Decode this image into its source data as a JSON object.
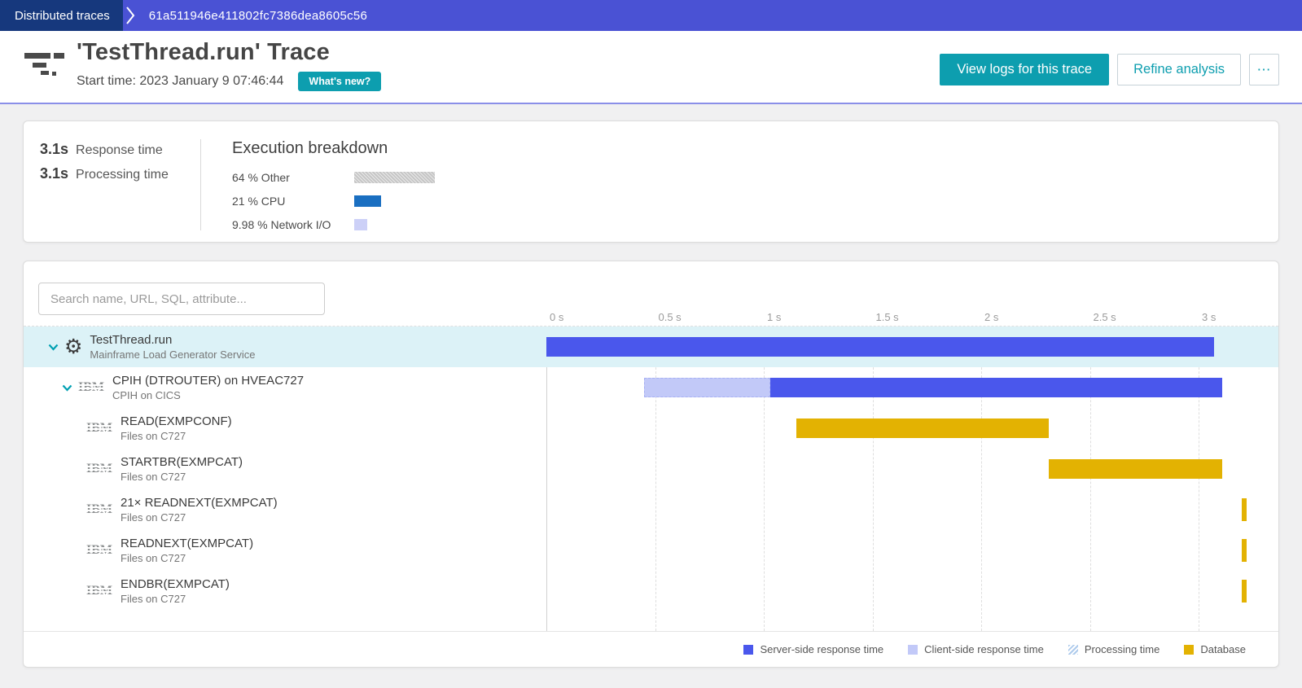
{
  "topbar": {
    "breadcrumb": "Distributed traces",
    "trace_id": "61a511946e411802fc7386dea8605c56"
  },
  "header": {
    "title": "'TestThread.run' Trace",
    "start_time": "Start time: 2023 January 9 07:46:44",
    "whats_new_label": "What's new?",
    "buttons": {
      "view_logs": "View logs for this trace",
      "refine": "Refine analysis",
      "more": "⋯"
    }
  },
  "summary": {
    "metrics": [
      {
        "value": "3.1s",
        "label": "Response time"
      },
      {
        "value": "3.1s",
        "label": "Processing time"
      }
    ],
    "breakdown": {
      "title": "Execution breakdown",
      "items": [
        {
          "label": "64 % Other",
          "pct": 64,
          "type": "other"
        },
        {
          "label": "21 % CPU",
          "pct": 21,
          "type": "cpu"
        },
        {
          "label": "9.98 % Network I/O",
          "pct": 9.98,
          "type": "network"
        }
      ]
    }
  },
  "waterfall": {
    "search_placeholder": "Search name, URL, SQL, attribute...",
    "axis_ticks": [
      {
        "t": 0,
        "label": "0 s"
      },
      {
        "t": 0.5,
        "label": "0.5 s"
      },
      {
        "t": 1,
        "label": "1 s"
      },
      {
        "t": 1.5,
        "label": "1.5 s"
      },
      {
        "t": 2,
        "label": "2 s"
      },
      {
        "t": 2.5,
        "label": "2.5 s"
      },
      {
        "t": 3,
        "label": "3 s"
      }
    ],
    "rows": [
      {
        "name": "TestThread.run",
        "service": "Mainframe Load Generator Service",
        "icon": "gear",
        "expandable": true,
        "highlighted": true,
        "indent": 0,
        "bars": [
          {
            "type": "server",
            "start_s": 0,
            "end_s": 3.07
          }
        ]
      },
      {
        "name": "CPIH (DTROUTER) on HVEAC727",
        "service": "CPIH on CICS",
        "icon": "ibm",
        "expandable": true,
        "highlighted": false,
        "indent": 1,
        "bars": [
          {
            "type": "client",
            "start_s": 0.45,
            "end_s": 1.03
          },
          {
            "type": "server",
            "start_s": 1.03,
            "end_s": 3.11
          }
        ]
      },
      {
        "name": "READ(EXMPCONF)",
        "service": "Files on C727",
        "icon": "ibm",
        "expandable": false,
        "highlighted": false,
        "indent": 2,
        "bars": [
          {
            "type": "database",
            "start_s": 1.15,
            "end_s": 2.31
          }
        ]
      },
      {
        "name": "STARTBR(EXMPCAT)",
        "service": "Files on C727",
        "icon": "ibm",
        "expandable": false,
        "highlighted": false,
        "indent": 2,
        "bars": [
          {
            "type": "database",
            "start_s": 2.31,
            "end_s": 3.11
          }
        ]
      },
      {
        "name": "21× READNEXT(EXMPCAT)",
        "service": "Files on C727",
        "icon": "ibm",
        "expandable": false,
        "highlighted": false,
        "indent": 2,
        "bars": [
          {
            "type": "database",
            "start_s": 3.2,
            "end_s": 3.22
          }
        ]
      },
      {
        "name": "READNEXT(EXMPCAT)",
        "service": "Files on C727",
        "icon": "ibm",
        "expandable": false,
        "highlighted": false,
        "indent": 2,
        "bars": [
          {
            "type": "database",
            "start_s": 3.2,
            "end_s": 3.22
          }
        ]
      },
      {
        "name": "ENDBR(EXMPCAT)",
        "service": "Files on C727",
        "icon": "ibm",
        "expandable": false,
        "highlighted": false,
        "indent": 2,
        "bars": [
          {
            "type": "database",
            "start_s": 3.2,
            "end_s": 3.22
          }
        ]
      }
    ],
    "legend": [
      {
        "label": "Server-side response time",
        "type": "server"
      },
      {
        "label": "Client-side response time",
        "type": "client"
      },
      {
        "label": "Processing time",
        "type": "processing"
      },
      {
        "label": "Database",
        "type": "database"
      }
    ]
  },
  "colors": {
    "navy": "#16387d",
    "indigo": "#4a52d4",
    "teal": "#0d9eaf",
    "server": "#4a57ec",
    "client": "#c2c9f8",
    "database": "#e3b202",
    "cpu": "#1a6fc1",
    "network": "#ccd0f7"
  },
  "chart_data": {
    "type": "waterfall-gantt",
    "time_axis_seconds": [
      0,
      0.5,
      1,
      1.5,
      2,
      2.5,
      3
    ],
    "spans": [
      {
        "name": "TestThread.run",
        "kind": "server-side response time",
        "start_s": 0,
        "end_s": 3.07
      },
      {
        "name": "CPIH (DTROUTER) on HVEAC727",
        "kind": "client-side response time",
        "start_s": 0.45,
        "end_s": 1.03
      },
      {
        "name": "CPIH (DTROUTER) on HVEAC727",
        "kind": "server-side response time",
        "start_s": 1.03,
        "end_s": 3.11
      },
      {
        "name": "READ(EXMPCONF)",
        "kind": "database",
        "start_s": 1.15,
        "end_s": 2.31
      },
      {
        "name": "STARTBR(EXMPCAT)",
        "kind": "database",
        "start_s": 2.31,
        "end_s": 3.11
      },
      {
        "name": "21× READNEXT(EXMPCAT)",
        "kind": "database",
        "start_s": 3.2,
        "end_s": 3.22
      },
      {
        "name": "READNEXT(EXMPCAT)",
        "kind": "database",
        "start_s": 3.2,
        "end_s": 3.22
      },
      {
        "name": "ENDBR(EXMPCAT)",
        "kind": "database",
        "start_s": 3.2,
        "end_s": 3.22
      }
    ]
  }
}
